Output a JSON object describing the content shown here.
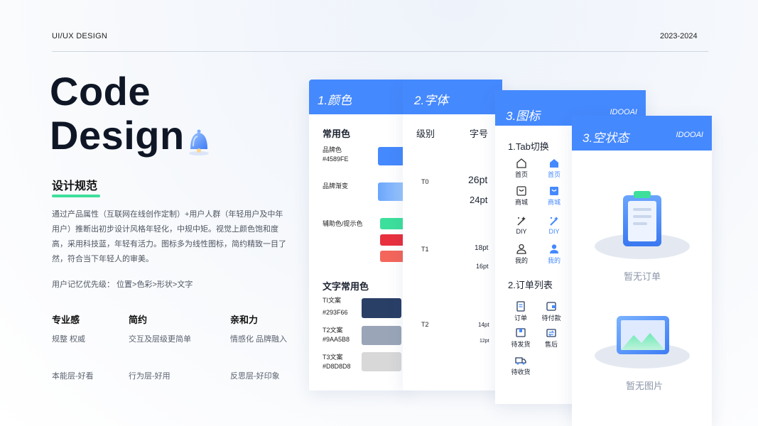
{
  "header": {
    "left_label": "UI/UX DESIGN",
    "right_label": "2023-2024"
  },
  "hero": {
    "line1": "Code",
    "line2": "Design"
  },
  "spec": {
    "title": "设计规范",
    "description": "通过产品属性（互联网在线创作定制）+用户人群（年轻用户及中年用户）推断出初步设计风格年轻化，中规中矩。视觉上颜色饱和度高，采用科技蓝，年轻有活力。图标多为线性图标，简约精致一目了然，符合当下年轻人的审美。",
    "memory": "用户记忆优先级：  位置>色彩>形状>文字"
  },
  "traits": [
    {
      "title": "专业感",
      "desc": "规整 权威",
      "layer": "本能层-好看"
    },
    {
      "title": "简约",
      "desc": "交互及层级更简单",
      "layer": "行为层-好用"
    },
    {
      "title": "亲和力",
      "desc": "情感化 品牌融入",
      "layer": "反思层-好印象"
    }
  ],
  "color_card": {
    "header": "1.颜色",
    "common_title": "常用色",
    "brand_label": "品牌色",
    "brand_hex": "#4589FE",
    "gradient_label": "品牌渐变",
    "aux_label": "辅助色/提示色",
    "text_title": "文字常用色",
    "text_colors": [
      {
        "label": "TI文案",
        "hex": "#293F66"
      },
      {
        "label": "T2文案",
        "hex": "#9AA5B8"
      },
      {
        "label": "T3文案",
        "hex": "#D8D8D8"
      }
    ],
    "colors": {
      "brand": "#4589fe",
      "grad_start": "#6ba6fb",
      "grad_end": "#a5ccfd",
      "aux_green": "#3ddf9c",
      "aux_red": "#e8303f",
      "aux_coral": "#f4665b",
      "t1": "#293f66",
      "t2": "#9aa5b8",
      "t3": "#d8d8d8"
    }
  },
  "font_card": {
    "header": "2.字体",
    "col_level": "级别",
    "col_size": "字号",
    "rows": [
      {
        "level": "T0",
        "size1": "26pt",
        "size2": "24pt"
      },
      {
        "level": "T1",
        "size1": "18pt",
        "size2": "16pt"
      },
      {
        "level": "T2",
        "size1": "14pt",
        "size2": "12pt"
      }
    ]
  },
  "icon_card": {
    "header": "3.图标",
    "brand": "IDOOAI",
    "tab_title": "1.Tab切换",
    "tabs": [
      "首页",
      "商城",
      "DIY",
      "我的"
    ],
    "order_title": "2.订单列表",
    "orders": [
      "订单",
      "待付款",
      "待发货",
      "售后",
      "待收货"
    ]
  },
  "empty_card": {
    "header": "3.空状态",
    "brand": "IDOOAI",
    "no_order": "暂无订单",
    "no_image": "暂无图片"
  }
}
